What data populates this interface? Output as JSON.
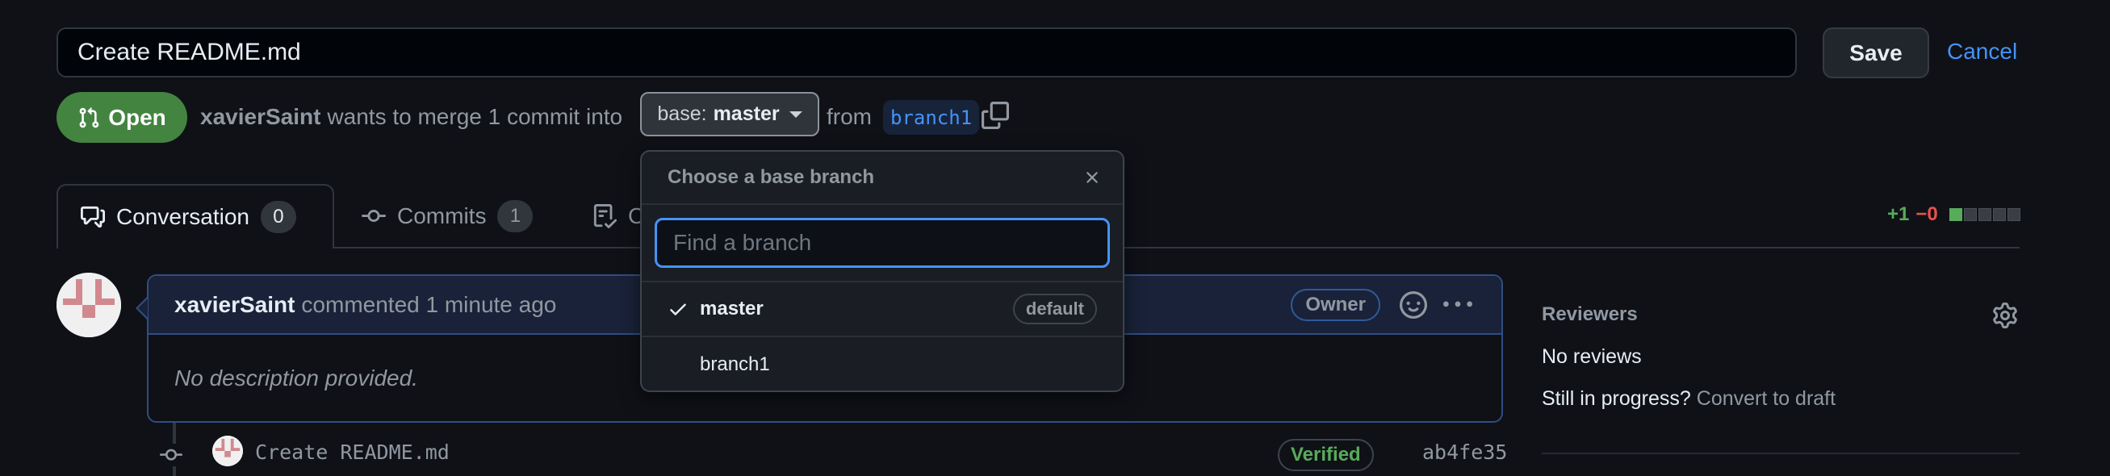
{
  "pr": {
    "title": "Create README.md",
    "save_label": "Save",
    "cancel_label": "Cancel",
    "state": "Open",
    "author": "xavierSaint",
    "merge_text": "wants to merge 1 commit into",
    "base_prefix": "base:",
    "base_branch": "master",
    "from_text": "from",
    "head_branch": "branch1"
  },
  "tabs": [
    {
      "label": "Conversation",
      "count": "0",
      "icon": "comment-discussion-icon",
      "active": true
    },
    {
      "label": "Commits",
      "count": "1",
      "icon": "git-commit-icon",
      "active": false
    },
    {
      "label": "Checks",
      "icon": "checklist-icon",
      "active": false
    }
  ],
  "diffstat": {
    "additions": "+1",
    "deletions": "−0",
    "blocks": [
      "add",
      "neutral",
      "neutral",
      "neutral",
      "neutral"
    ]
  },
  "comment": {
    "author": "xavierSaint",
    "action": "commented 1 minute ago",
    "badge": "Owner",
    "body": "No description provided."
  },
  "commit": {
    "message": "Create README.md",
    "verified_label": "Verified",
    "sha": "ab4fe35"
  },
  "sidebar": {
    "reviewers_heading": "Reviewers",
    "no_reviews": "No reviews",
    "draft_prompt": "Still in progress?",
    "draft_link": "Convert to draft"
  },
  "branch_dropdown": {
    "title": "Choose a base branch",
    "filter_placeholder": "Find a branch",
    "filter_value": "",
    "items": [
      {
        "name": "master",
        "selected": true,
        "badge": "default"
      },
      {
        "name": "branch1",
        "selected": false
      }
    ]
  },
  "colors": {
    "open_green": "#438440",
    "link_blue": "#4493f8",
    "addition": "#57ab5a",
    "deletion": "#e5534b"
  }
}
